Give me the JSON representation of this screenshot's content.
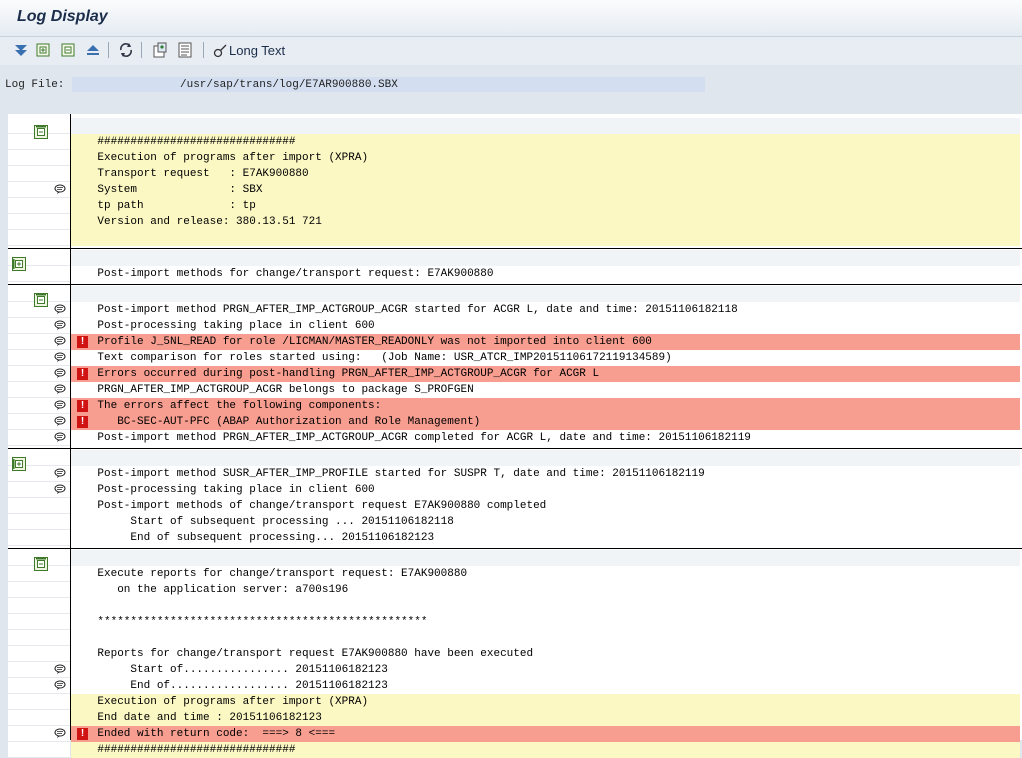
{
  "title": "Log Display",
  "toolbar": {
    "long_text_label": "Long Text",
    "icons": [
      "expand-all-icon",
      "expand-node-icon",
      "collapse-node-icon",
      "collapse-all-icon",
      "refresh-icon",
      "details-icon",
      "list-icon",
      "long-text-icon"
    ]
  },
  "log_file": {
    "label": "Log File:",
    "value": "/usr/sap/trans/log/E7AR900880.SBX"
  },
  "groups": [
    {
      "icon": "node-open-icon",
      "rows": [
        {
          "text": "",
          "style": "grey",
          "bubble": false,
          "error": false
        },
        {
          "text": "    ##############################",
          "style": "yellow",
          "bubble": false,
          "error": false
        },
        {
          "text": "    Execution of programs after import (XPRA)",
          "style": "yellow",
          "bubble": false,
          "error": false
        },
        {
          "text": "    Transport request   : E7AK900880",
          "style": "yellow",
          "bubble": false,
          "error": false
        },
        {
          "text": "    System              : SBX",
          "style": "yellow",
          "bubble": true,
          "error": false
        },
        {
          "text": "    tp path             : tp",
          "style": "yellow",
          "bubble": false,
          "error": false
        },
        {
          "text": "    Version and release: 380.13.51 721",
          "style": "yellow",
          "bubble": false,
          "error": false
        },
        {
          "text": "",
          "style": "yellow",
          "bubble": false,
          "error": false
        }
      ]
    },
    {
      "icon": "node-collapsed-icon",
      "rows": [
        {
          "text": "",
          "style": "grey",
          "bubble": false,
          "error": false
        },
        {
          "text": "    Post-import methods for change/transport request: E7AK900880",
          "style": "white",
          "bubble": false,
          "error": false
        }
      ]
    },
    {
      "icon": "node-open-icon",
      "rows": [
        {
          "text": "",
          "style": "grey",
          "bubble": false,
          "error": false
        },
        {
          "text": "    Post-import method PRGN_AFTER_IMP_ACTGROUP_ACGR started for ACGR L, date and time: 20151106182118",
          "style": "white",
          "bubble": true,
          "error": false
        },
        {
          "text": "    Post-processing taking place in client 600",
          "style": "white",
          "bubble": true,
          "error": false
        },
        {
          "text": "    Profile J_5NL_READ for role /LICMAN/MASTER_READONLY was not imported into client 600",
          "style": "red",
          "bubble": true,
          "error": true
        },
        {
          "text": "    Text comparison for roles started using:   (Job Name: USR_ATCR_IMP20151106172119134589)",
          "style": "white",
          "bubble": true,
          "error": false
        },
        {
          "text": "    Errors occurred during post-handling PRGN_AFTER_IMP_ACTGROUP_ACGR for ACGR L",
          "style": "red",
          "bubble": true,
          "error": true
        },
        {
          "text": "    PRGN_AFTER_IMP_ACTGROUP_ACGR belongs to package S_PROFGEN",
          "style": "white",
          "bubble": true,
          "error": false
        },
        {
          "text": "    The errors affect the following components:",
          "style": "red",
          "bubble": true,
          "error": true
        },
        {
          "text": "       BC-SEC-AUT-PFC (ABAP Authorization and Role Management)",
          "style": "red",
          "bubble": true,
          "error": true
        },
        {
          "text": "    Post-import method PRGN_AFTER_IMP_ACTGROUP_ACGR completed for ACGR L, date and time: 20151106182119",
          "style": "white",
          "bubble": true,
          "error": false
        }
      ]
    },
    {
      "icon": "node-collapsed-icon",
      "rows": [
        {
          "text": "",
          "style": "grey",
          "bubble": false,
          "error": false
        },
        {
          "text": "    Post-import method SUSR_AFTER_IMP_PROFILE started for SUSPR T, date and time: 20151106182119",
          "style": "white",
          "bubble": true,
          "error": false
        },
        {
          "text": "    Post-processing taking place in client 600",
          "style": "white",
          "bubble": true,
          "error": false
        },
        {
          "text": "    Post-import methods of change/transport request E7AK900880 completed",
          "style": "white",
          "bubble": false,
          "error": false
        },
        {
          "text": "         Start of subsequent processing ... 20151106182118",
          "style": "white",
          "bubble": false,
          "error": false
        },
        {
          "text": "         End of subsequent processing... 20151106182123",
          "style": "white",
          "bubble": false,
          "error": false
        }
      ]
    },
    {
      "icon": "node-open-icon",
      "rows": [
        {
          "text": "",
          "style": "grey",
          "bubble": false,
          "error": false
        },
        {
          "text": "    Execute reports for change/transport request: E7AK900880",
          "style": "white",
          "bubble": false,
          "error": false
        },
        {
          "text": "       on the application server: a700s196",
          "style": "white",
          "bubble": false,
          "error": false
        },
        {
          "text": "",
          "style": "white",
          "bubble": false,
          "error": false
        },
        {
          "text": "    **************************************************",
          "style": "white",
          "bubble": false,
          "error": false
        },
        {
          "text": "",
          "style": "white",
          "bubble": false,
          "error": false
        },
        {
          "text": "    Reports for change/transport request E7AK900880 have been executed",
          "style": "white",
          "bubble": false,
          "error": false
        },
        {
          "text": "         Start of................ 20151106182123",
          "style": "white",
          "bubble": true,
          "error": false
        },
        {
          "text": "         End of.................. 20151106182123",
          "style": "white",
          "bubble": true,
          "error": false
        },
        {
          "text": "    Execution of programs after import (XPRA)",
          "style": "yellow",
          "bubble": false,
          "error": false
        },
        {
          "text": "    End date and time : 20151106182123",
          "style": "yellow",
          "bubble": false,
          "error": false
        },
        {
          "text": "    Ended with return code:  ===> 8 <===",
          "style": "red",
          "bubble": true,
          "error": true
        },
        {
          "text": "    ##############################",
          "style": "yellow",
          "bubble": false,
          "error": false
        }
      ]
    }
  ]
}
